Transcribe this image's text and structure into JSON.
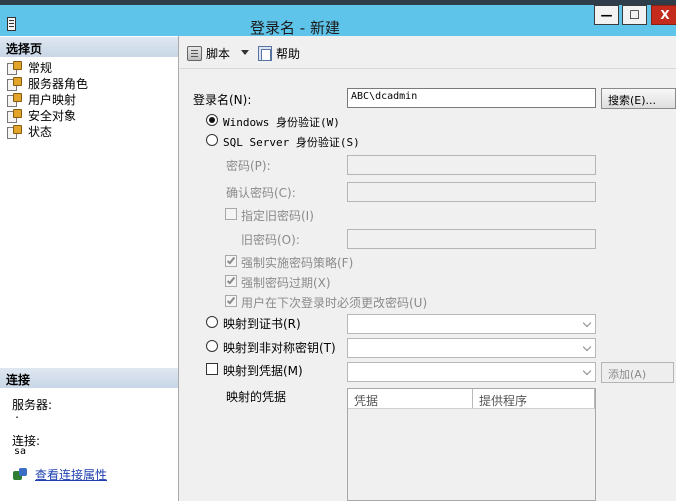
{
  "window": {
    "title": "登录名 - 新建",
    "minimize_glyph": "—",
    "maximize_glyph": "☐",
    "close_glyph": "X"
  },
  "left": {
    "select_page_header": "选择页",
    "pages": [
      "常规",
      "服务器角色",
      "用户映射",
      "安全对象",
      "状态"
    ],
    "connection_header": "连接",
    "server_label": "服务器:",
    "server_value": ".",
    "connection_label": "连接:",
    "connection_value": "sa",
    "view_connection_link": "查看连接属性"
  },
  "toolbar": {
    "script_label": "脚本",
    "help_label": "帮助"
  },
  "form": {
    "login_name_label": "登录名(N):",
    "login_name_value": "ABC\\dcadmin",
    "search_button": "搜索(E)...",
    "windows_auth_label": "Windows 身份验证(W)",
    "sql_auth_label": "SQL Server 身份验证(S)",
    "password_label": "密码(P):",
    "confirm_password_label": "确认密码(C):",
    "specify_old_password_label": "指定旧密码(I)",
    "old_password_label": "旧密码(O):",
    "enforce_policy_label": "强制实施密码策略(F)",
    "enforce_expiration_label": "强制密码过期(X)",
    "must_change_label": "用户在下次登录时必须更改密码(U)",
    "map_certificate_label": "映射到证书(R)",
    "map_asymmetric_key_label": "映射到非对称密钥(T)",
    "map_credential_label": "映射到凭据(M)",
    "add_button": "添加(A)",
    "mapped_credentials_label": "映射的凭据",
    "credentials_columns": [
      "凭据",
      "提供程序"
    ]
  }
}
